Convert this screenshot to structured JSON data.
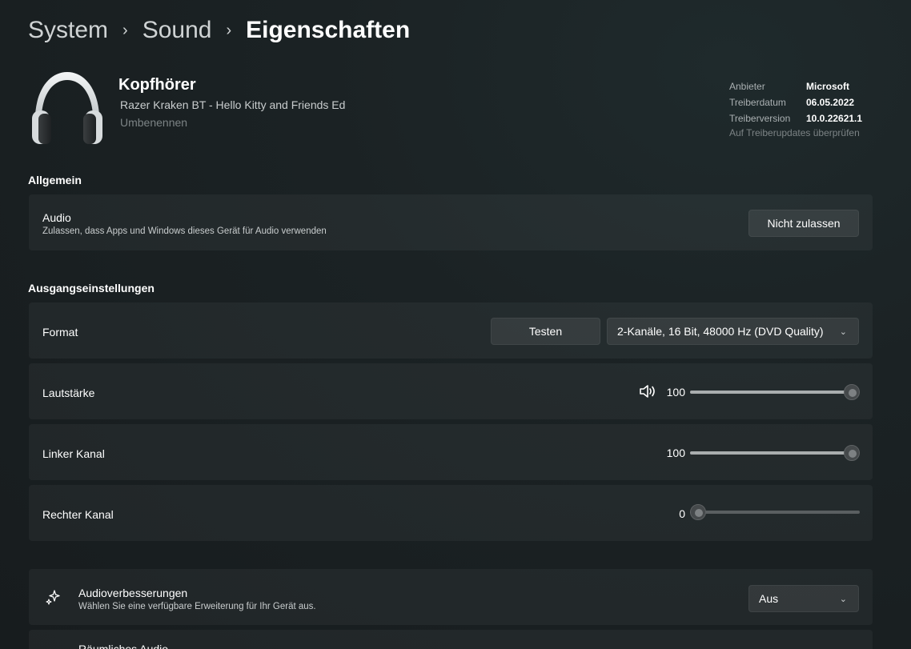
{
  "breadcrumb": {
    "item1": "System",
    "item2": "Sound",
    "item3": "Eigenschaften",
    "separator": "›"
  },
  "device": {
    "name": "Kopfhörer",
    "subtitle": "Razer Kraken BT - Hello Kitty and Friends Ed",
    "rename": "Umbenennen",
    "icon": "headphones-icon"
  },
  "driver": {
    "provider_label": "Anbieter",
    "provider_value": "Microsoft",
    "date_label": "Treiberdatum",
    "date_value": "06.05.2022",
    "version_label": "Treiberversion",
    "version_value": "10.0.22621.1",
    "update_link": "Auf Treiberupdates überprüfen"
  },
  "general": {
    "title": "Allgemein",
    "audio_label": "Audio",
    "audio_desc": "Zulassen, dass Apps und Windows dieses Gerät für Audio verwenden",
    "audio_button": "Nicht zulassen"
  },
  "output": {
    "title": "Ausgangseinstellungen",
    "format_label": "Format",
    "test_button": "Testen",
    "format_value": "2-Kanäle, 16 Bit, 48000 Hz (DVD Quality)",
    "volume_label": "Lautstärke",
    "volume_value": "100",
    "left_label": "Linker Kanal",
    "left_value": "100",
    "right_label": "Rechter Kanal",
    "right_value": "0"
  },
  "enhancements": {
    "label": "Audioverbesserungen",
    "desc": "Wählen Sie eine verfügbare Erweiterung für Ihr Gerät aus.",
    "value": "Aus",
    "icon": "sparkle-icon"
  },
  "spatial": {
    "label": "Räumliches Audio"
  },
  "sliders": {
    "volume": 1.0,
    "left": 1.0,
    "right": 0.0
  },
  "colors": {
    "background": "#1b2224",
    "card": "#252b2d",
    "accent_text": "#ffffff"
  }
}
